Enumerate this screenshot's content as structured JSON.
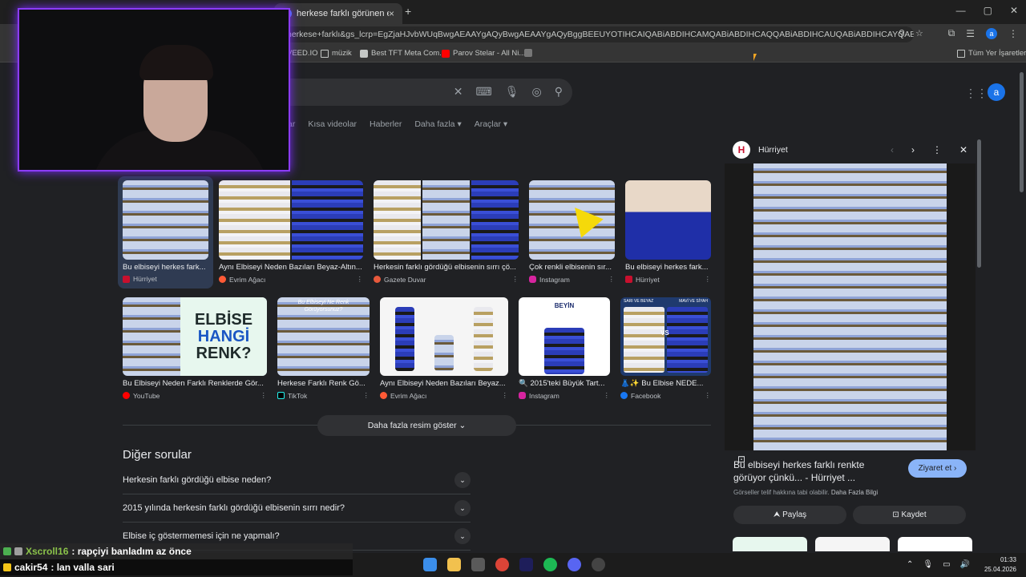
{
  "browser": {
    "tabs": [
      {
        "label": "",
        "close": "×"
      },
      {
        "label": "herkese farklı görünen elbise -",
        "close": "×"
      }
    ],
    "new_tab": "+",
    "window_buttons": [
      "—",
      "▢",
      "✕"
    ],
    "url": "herkese+farklı&gs_lcrp=EgZjaHJvbWUqBwgAEAAYgAQyBwgAEAAYgAQyBggBEEUYOTIHCAIQABiABDIHCAMQABiABDIHCAQQABiABDIHCAUQABiABDIHCAYQABiABDIHCAcQABiABDIH...",
    "profile_letter": "a",
    "bookmarks": [
      {
        "label": "VEED.IO"
      },
      {
        "label": "müzik"
      },
      {
        "label": "Best TFT Meta Com..."
      },
      {
        "label": "Parov Stelar - All Ni..."
      }
    ],
    "all_bookmarks": "Tüm Yer İşaretleri"
  },
  "google": {
    "search_value": "",
    "avatar_letter": "a",
    "filters": [
      "Videolar",
      "Kısa videolar",
      "Haberler",
      "Daha fazla ▾",
      "Araçlar ▾"
    ]
  },
  "images_row1": [
    {
      "caption": "Bu elbiseyi herkes fark...",
      "source": "Hürriyet"
    },
    {
      "caption": "Aynı Elbiseyi Neden Bazıları Beyaz-Altın...",
      "source": "Evrim Ağacı"
    },
    {
      "caption": "Herkesin farklı gördüğü elbisenin sırrı çö...",
      "source": "Gazete Duvar"
    },
    {
      "caption": "Çok renkli elbisenin sır...",
      "source": "Instagram"
    },
    {
      "caption": "Bu elbiseyi herkes fark...",
      "source": "Hürriyet"
    }
  ],
  "images_row2": [
    {
      "caption": "Bu Elbiseyi Neden Farklı Renklerde Gör...",
      "source": "YouTube",
      "overlay": [
        "ELBİSE",
        "HANGİ",
        "RENK?"
      ]
    },
    {
      "caption": "Herkese Farklı Renk Gö...",
      "source": "TikTok",
      "overlay": [
        "Bu Elbiseyi Ne Renk",
        "Görüyorsunuz?"
      ]
    },
    {
      "caption": "Aynı Elbiseyi Neden Bazıları Beyaz...",
      "source": "Evrim Ağacı"
    },
    {
      "caption": "🔍 2015'teki Büyük Tart...",
      "source": "Instagram",
      "overlay": [
        "BEYİN"
      ]
    },
    {
      "caption": "👗✨ Bu Elbise NEDE...",
      "source": "Facebook",
      "overlay": [
        "SARI VE BEYAZ",
        "MAVİ VE SİYAH",
        "VS"
      ]
    }
  ],
  "more_images": "Daha fazla resim göster ⌄",
  "faq": {
    "title": "Diğer sorular",
    "items": [
      "Herkesin farklı gördüğü elbise neden?",
      "2015 yılında herkesin farklı gördüğü elbisenin sırrı nedir?",
      "Elbise iç göstermemesi için ne yapmalı?"
    ]
  },
  "panel": {
    "source": "Hürriyet",
    "logo": "H",
    "title": "Bu elbiseyi herkes farklı renkte görüyor çünkü... - Hürriyet ...",
    "visit": "Ziyaret et ›",
    "note": "Görseller telif hakkına tabi olabilir.",
    "note_link": "Daha Fazla Bilgi",
    "share": "⮝ Paylaş",
    "save": "⊡ Kaydet"
  },
  "chat": [
    {
      "user": "Xscroll16",
      "message": " : rapçiyi banladım az önce",
      "color": "#8bc34a"
    },
    {
      "user": "cakir54",
      "message": " : lan valla sari",
      "color": "#ffffff"
    }
  ],
  "taskbar": {
    "time": "01:33",
    "date": "25.04.2026"
  }
}
